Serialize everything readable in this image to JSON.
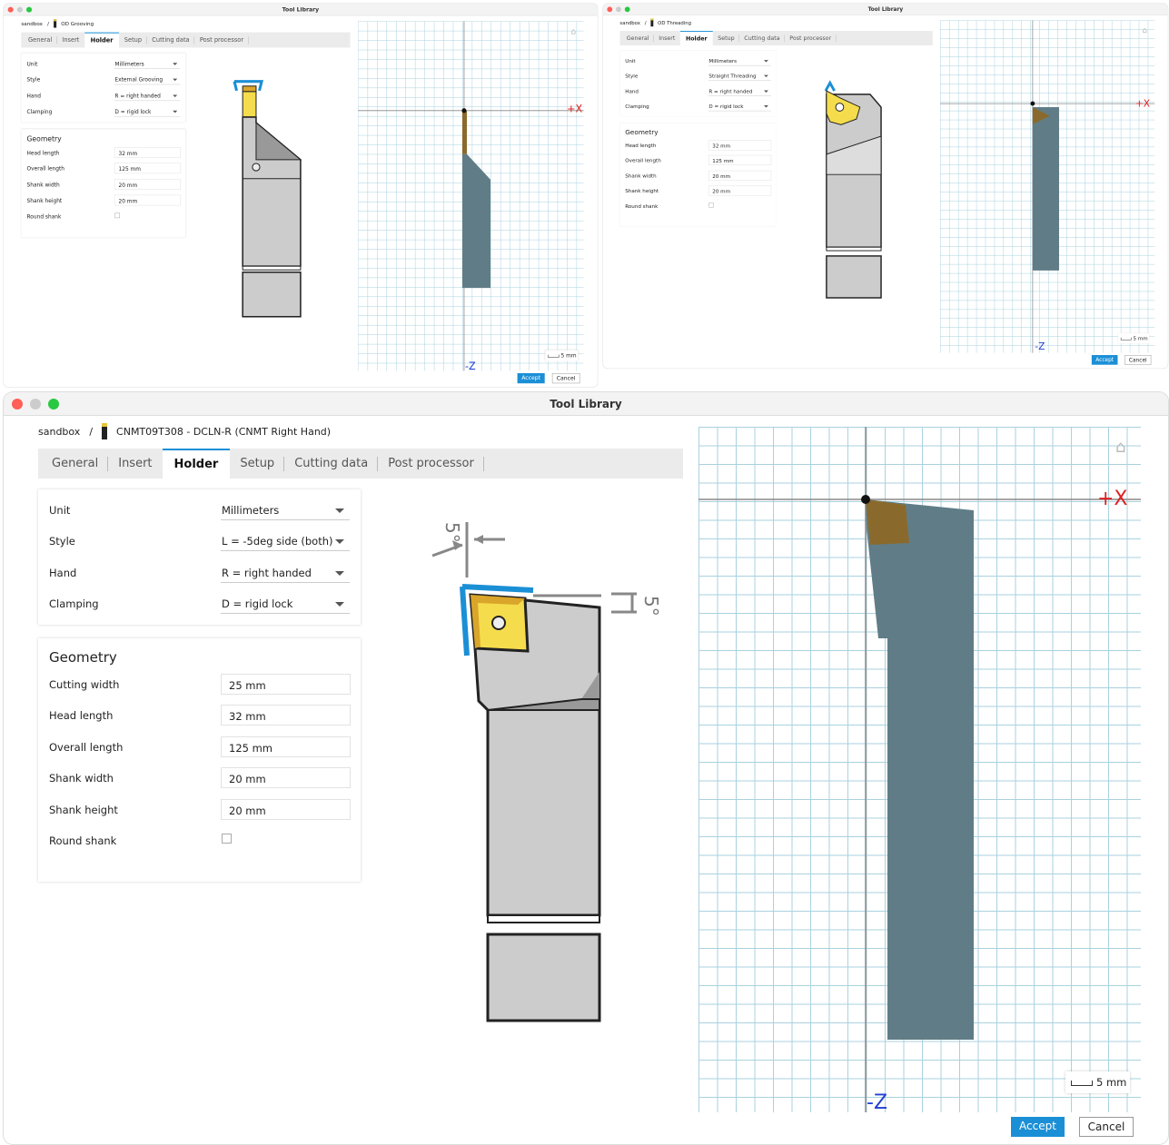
{
  "windows": [
    {
      "title": "Tool Library",
      "breadcrumb": {
        "root": "sandbox",
        "sep": "/",
        "tool": "OD Grooving"
      },
      "tabs": [
        "General",
        "Insert",
        "Holder",
        "Setup",
        "Cutting data",
        "Post processor"
      ],
      "active_tab": "Holder",
      "settings": [
        {
          "label": "Unit",
          "value": "Millimeters"
        },
        {
          "label": "Style",
          "value": "External Grooving"
        },
        {
          "label": "Hand",
          "value": "R = right handed"
        },
        {
          "label": "Clamping",
          "value": "D = rigid lock"
        }
      ],
      "geometry": {
        "title": "Geometry",
        "fields": [
          {
            "label": "Head length",
            "value": "32 mm"
          },
          {
            "label": "Overall length",
            "value": "125 mm"
          },
          {
            "label": "Shank width",
            "value": "20 mm"
          },
          {
            "label": "Shank height",
            "value": "20 mm"
          }
        ],
        "round_shank": {
          "label": "Round shank",
          "checked": false
        }
      },
      "angles": [],
      "axis": {
        "x": "+X",
        "z": "-Z"
      },
      "scale": "5 mm",
      "buttons": {
        "accept": "Accept",
        "cancel": "Cancel"
      }
    },
    {
      "title": "Tool Library",
      "breadcrumb": {
        "root": "sandbox",
        "sep": "/",
        "tool": "OD Threading"
      },
      "tabs": [
        "General",
        "Insert",
        "Holder",
        "Setup",
        "Cutting data",
        "Post processor"
      ],
      "active_tab": "Holder",
      "settings": [
        {
          "label": "Unit",
          "value": "Millimeters"
        },
        {
          "label": "Style",
          "value": "Straight Threading"
        },
        {
          "label": "Hand",
          "value": "R = right handed"
        },
        {
          "label": "Clamping",
          "value": "D = rigid lock"
        }
      ],
      "geometry": {
        "title": "Geometry",
        "fields": [
          {
            "label": "Head length",
            "value": "32 mm"
          },
          {
            "label": "Overall length",
            "value": "125 mm"
          },
          {
            "label": "Shank width",
            "value": "20 mm"
          },
          {
            "label": "Shank height",
            "value": "20 mm"
          }
        ],
        "round_shank": {
          "label": "Round shank",
          "checked": false
        }
      },
      "angles": [],
      "axis": {
        "x": "+X",
        "z": "-Z"
      },
      "scale": "5 mm",
      "buttons": {
        "accept": "Accept",
        "cancel": "Cancel"
      }
    },
    {
      "title": "Tool Library",
      "breadcrumb": {
        "root": "sandbox",
        "sep": "/",
        "tool": "CNMT09T308 - DCLN-R (CNMT Right Hand)"
      },
      "tabs": [
        "General",
        "Insert",
        "Holder",
        "Setup",
        "Cutting data",
        "Post processor"
      ],
      "active_tab": "Holder",
      "settings": [
        {
          "label": "Unit",
          "value": "Millimeters"
        },
        {
          "label": "Style",
          "value": "L = -5deg side (both)"
        },
        {
          "label": "Hand",
          "value": "R = right handed"
        },
        {
          "label": "Clamping",
          "value": "D = rigid lock"
        }
      ],
      "geometry": {
        "title": "Geometry",
        "fields": [
          {
            "label": "Cutting width",
            "value": "25 mm"
          },
          {
            "label": "Head length",
            "value": "32 mm"
          },
          {
            "label": "Overall length",
            "value": "125 mm"
          },
          {
            "label": "Shank width",
            "value": "20 mm"
          },
          {
            "label": "Shank height",
            "value": "20 mm"
          }
        ],
        "round_shank": {
          "label": "Round shank",
          "checked": false
        }
      },
      "angles": [
        "5°",
        "5°"
      ],
      "axis": {
        "x": "+X",
        "z": "-Z"
      },
      "scale": "5 mm",
      "buttons": {
        "accept": "Accept",
        "cancel": "Cancel"
      }
    }
  ],
  "colors": {
    "accent": "#1b8fd6",
    "insert": "#f5dc4c",
    "tool_preview": "#607d87",
    "insert_preview": "#8a6a2c",
    "axis_label": "#e02020",
    "z_label": "#1f3fd0"
  }
}
